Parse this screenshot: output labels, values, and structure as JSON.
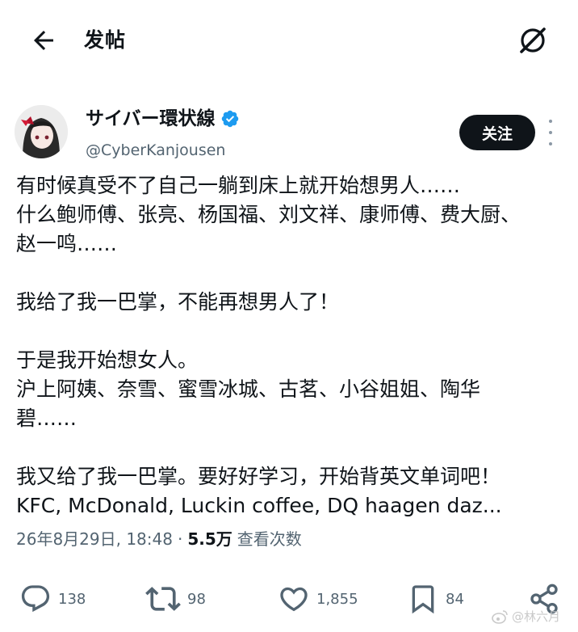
{
  "header": {
    "title": "发帖",
    "back_icon": "arrow-left-icon",
    "right_icon": "grok-icon"
  },
  "author": {
    "name": "サイバー環状線",
    "handle": "@CyberKanjousen",
    "verified": true,
    "avatar_icon": "anime-avatar"
  },
  "follow_label": "关注",
  "tweet": {
    "lines": [
      "有时候真受不了自己一躺到床上就开始想男人……",
      "什么鲍师傅、张亮、杨国福、刘文祥、康师傅、费大厨、",
      "赵一鸣……",
      "",
      "我给了我一巴掌，不能再想男人了！",
      "",
      "于是我开始想女人。",
      "沪上阿姨、奈雪、蜜雪冰城、古茗、小谷姐姐、陶华",
      "碧……",
      "",
      "我又给了我一巴掌。要好好学习，开始背英文单词吧！",
      "KFC, McDonald, Luckin coffee, DQ haagen daz..."
    ]
  },
  "meta": {
    "timestamp": "26年8月29日, 18:48",
    "dot": "·",
    "views_count": "5.5万",
    "views_label": "查看次数"
  },
  "actions": {
    "reply_count": "138",
    "repost_count": "98",
    "like_count": "1,855",
    "bookmark_count": "84"
  },
  "watermark": {
    "text": "@林六月"
  },
  "colors": {
    "text": "#0f1419",
    "secondary": "#536471",
    "verified": "#1d9bf0",
    "button_bg": "#0f1419"
  }
}
